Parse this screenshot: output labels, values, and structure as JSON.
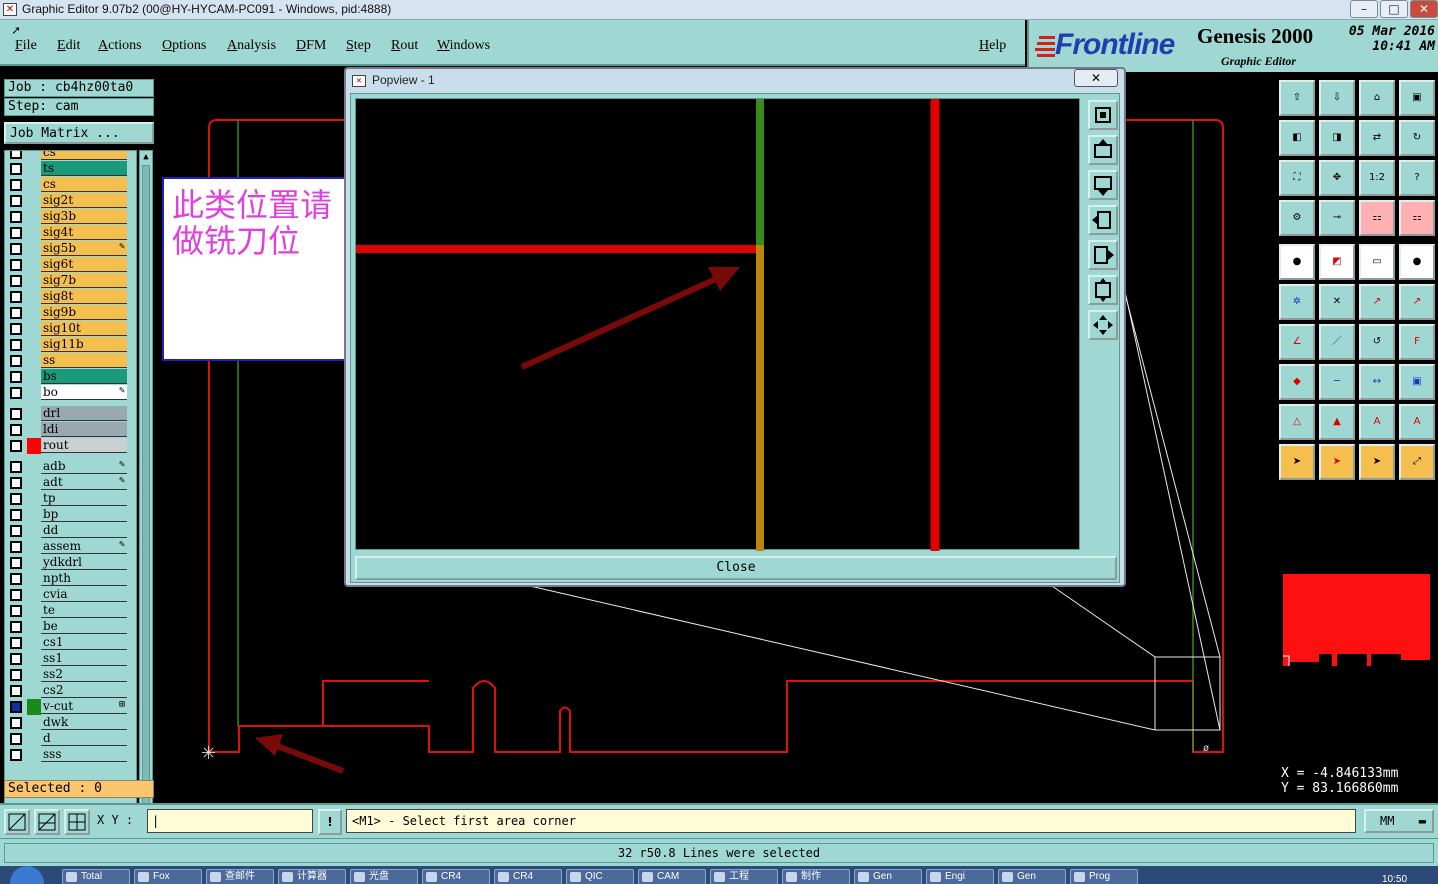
{
  "window": {
    "title": "Graphic Editor 9.07b2 (00@HY-HYCAM-PC091 - Windows, pid:4888)",
    "controls": [
      "–",
      "□",
      "✕"
    ]
  },
  "menu": {
    "items": [
      "File",
      "Edit",
      "Actions",
      "Options",
      "Analysis",
      "DFM",
      "Step",
      "Rout",
      "Windows"
    ],
    "help": "Help"
  },
  "branding": {
    "logo": "Frontline",
    "product": "Genesis 2000",
    "subtitle": "Graphic Editor",
    "date": "05 Mar 2016",
    "time": "10:41 AM"
  },
  "job": {
    "job_line": "Job : cb4hz00ta0",
    "step_line": "Step: cam",
    "matrix_button": "Job Matrix ..."
  },
  "layers": [
    {
      "name": "cs",
      "color": "#f5bf4f",
      "mark": ""
    },
    {
      "name": "ts",
      "color": "#1a9a7a",
      "mark": ""
    },
    {
      "name": "cs",
      "color": "#f5bf4f",
      "mark": ""
    },
    {
      "name": "sig2t",
      "color": "#f5bf4f",
      "mark": ""
    },
    {
      "name": "sig3b",
      "color": "#f5bf4f",
      "mark": ""
    },
    {
      "name": "sig4t",
      "color": "#f5bf4f",
      "mark": ""
    },
    {
      "name": "sig5b",
      "color": "#f5bf4f",
      "mark": "✎"
    },
    {
      "name": "sig6t",
      "color": "#f5bf4f",
      "mark": ""
    },
    {
      "name": "sig7b",
      "color": "#f5bf4f",
      "mark": ""
    },
    {
      "name": "sig8t",
      "color": "#f5bf4f",
      "mark": ""
    },
    {
      "name": "sig9b",
      "color": "#f5bf4f",
      "mark": ""
    },
    {
      "name": "sig10t",
      "color": "#f5bf4f",
      "mark": ""
    },
    {
      "name": "sig11b",
      "color": "#f5bf4f",
      "mark": ""
    },
    {
      "name": "ss",
      "color": "#f5bf4f",
      "mark": ""
    },
    {
      "name": "bs",
      "color": "#1a9a7a",
      "mark": ""
    },
    {
      "name": "bo",
      "color": "#ffffff",
      "mark": "✎"
    },
    {
      "name": "drl",
      "color": "#9aa8b0",
      "mark": ""
    },
    {
      "name": "ldi",
      "color": "#9aa8b0",
      "mark": ""
    },
    {
      "name": "rout",
      "color": "#c8d0d4",
      "mark": "",
      "swatch": "#ff0000"
    },
    {
      "name": "adb",
      "color": "#9fd8d3",
      "mark": "✎"
    },
    {
      "name": "adt",
      "color": "#9fd8d3",
      "mark": "✎"
    },
    {
      "name": "tp",
      "color": "#9fd8d3",
      "mark": ""
    },
    {
      "name": "bp",
      "color": "#9fd8d3",
      "mark": ""
    },
    {
      "name": "dd",
      "color": "#9fd8d3",
      "mark": ""
    },
    {
      "name": "assem",
      "color": "#9fd8d3",
      "mark": "✎"
    },
    {
      "name": "ydkdrl",
      "color": "#9fd8d3",
      "mark": ""
    },
    {
      "name": "npth",
      "color": "#9fd8d3",
      "mark": ""
    },
    {
      "name": "cvia",
      "color": "#9fd8d3",
      "mark": ""
    },
    {
      "name": "te",
      "color": "#9fd8d3",
      "mark": ""
    },
    {
      "name": "be",
      "color": "#9fd8d3",
      "mark": ""
    },
    {
      "name": "cs1",
      "color": "#9fd8d3",
      "mark": ""
    },
    {
      "name": "ss1",
      "color": "#9fd8d3",
      "mark": ""
    },
    {
      "name": "ss2",
      "color": "#9fd8d3",
      "mark": ""
    },
    {
      "name": "cs2",
      "color": "#9fd8d3",
      "mark": ""
    },
    {
      "name": "v-cut",
      "color": "#9fd8d3",
      "mark": "⊞",
      "swatch": "#1a8a1a",
      "checked": true
    },
    {
      "name": "dwk",
      "color": "#9fd8d3",
      "mark": ""
    },
    {
      "name": "d",
      "color": "#9fd8d3",
      "mark": ""
    },
    {
      "name": "sss",
      "color": "#9fd8d3",
      "mark": ""
    }
  ],
  "selected": "Selected : 0",
  "popview": {
    "title": "Popview - 1",
    "close_x": "✕",
    "close_button": "Close"
  },
  "note": {
    "text": "此类位置请做铣刀位"
  },
  "coords": {
    "x": "X = -4.846133mm",
    "y": "Y = 83.166860mm"
  },
  "bottom": {
    "xy_label": "X Y :",
    "prompt": "<M1> - Select first area corner",
    "units": "MM",
    "warn": "!"
  },
  "status": "32 r50.8 Lines were selected",
  "taskbar": {
    "items": [
      "Total",
      "Fox",
      "查邮件",
      "计算器",
      "光盘",
      "CR4",
      "CR4",
      "QIC",
      "CAM",
      "工程",
      "制作",
      "Gen",
      "Engi",
      "Gen",
      "Prog"
    ],
    "clock": "10:50"
  },
  "colors": {
    "panel": "#9fd8d3",
    "rout": "#ff0000",
    "vcut": "#3a8a1a",
    "signal": "#f5bf4f"
  }
}
